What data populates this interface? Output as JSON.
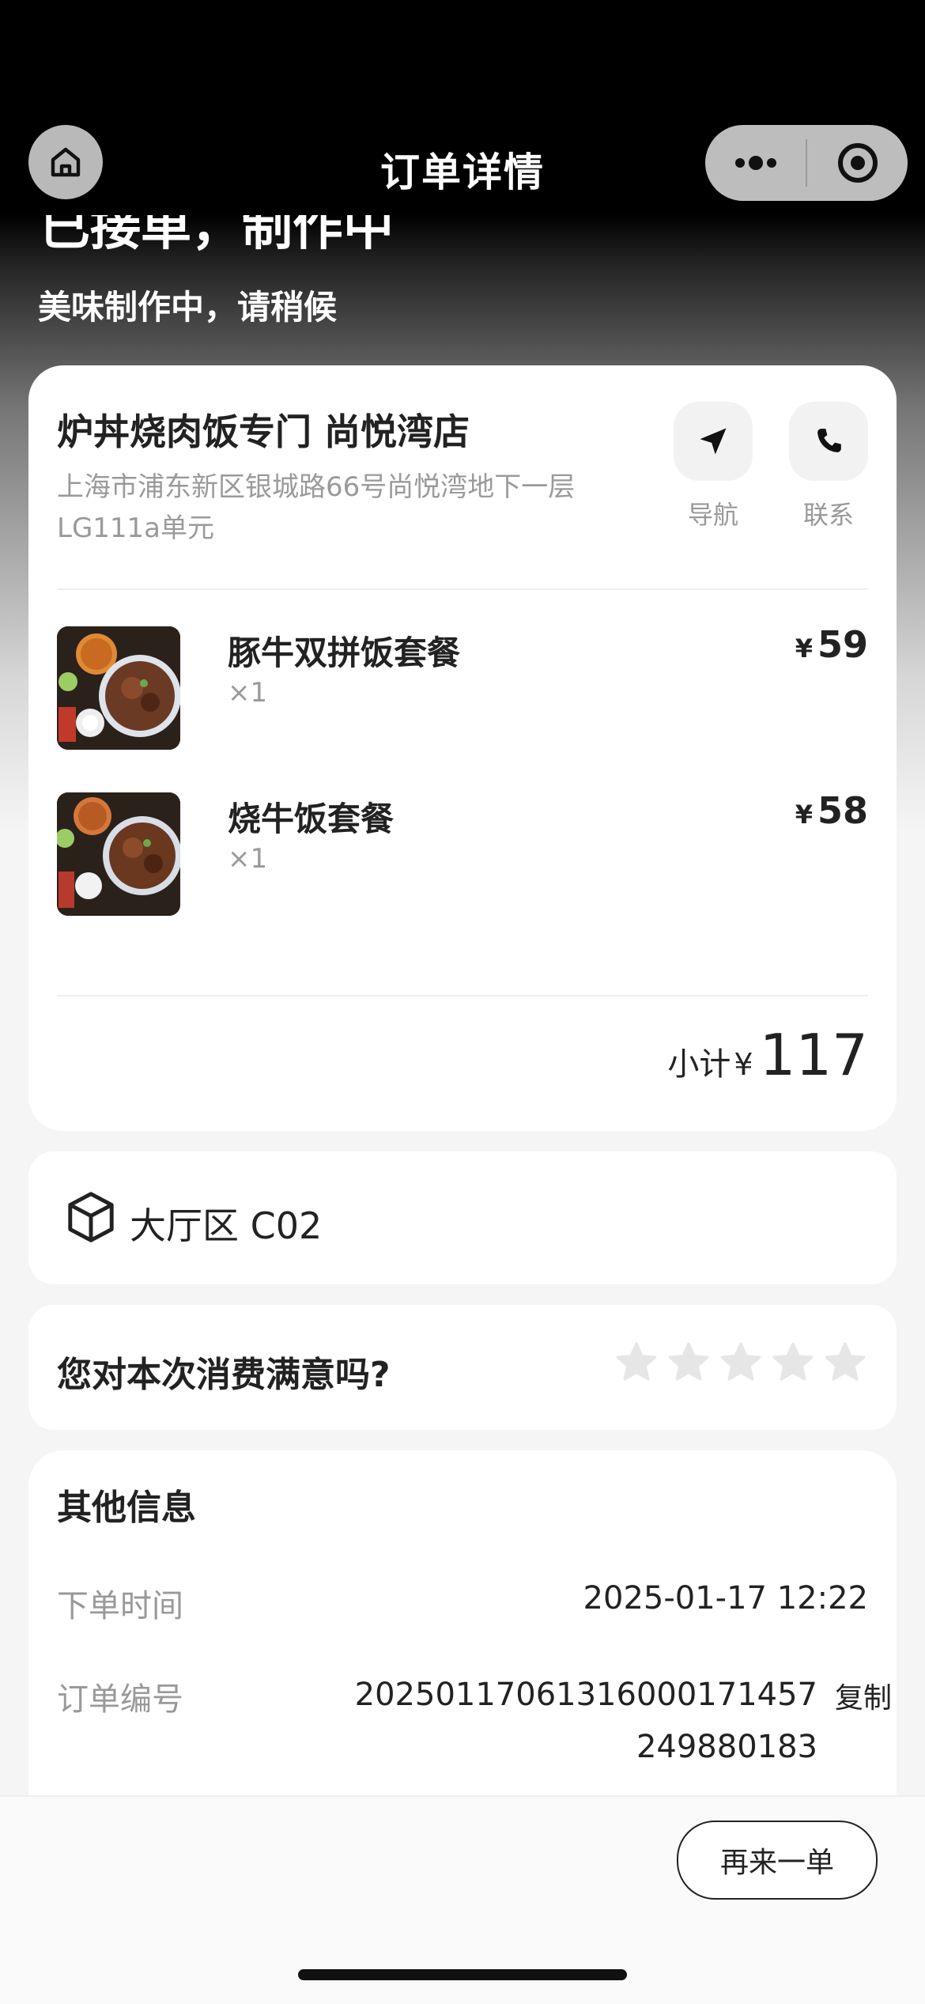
{
  "navbar": {
    "title": "订单详情"
  },
  "status": {
    "title": "已接单，制作中",
    "subtitle": "美味制作中，请稍候"
  },
  "store": {
    "name": "炉丼烧肉饭专门 尚悦湾店",
    "address": "上海市浦东新区银城路66号尚悦湾地下一层LG111a单元",
    "navigate_label": "导航",
    "contact_label": "联系"
  },
  "items": [
    {
      "name": "豚牛双拼饭套餐",
      "qty": "×1",
      "currency": "¥",
      "price": "59"
    },
    {
      "name": "烧牛饭套餐",
      "qty": "×1",
      "currency": "¥",
      "price": "58"
    }
  ],
  "subtotal": {
    "label": "小计",
    "currency": "¥",
    "value": "117"
  },
  "table": {
    "text": "大厅区 C02"
  },
  "rating": {
    "question": "您对本次消费满意吗?",
    "stars": 0,
    "max_stars": 5,
    "star_color": "#e6e6e6"
  },
  "info": {
    "title": "其他信息",
    "order_time_label": "下单时间",
    "order_time": "2025-01-17 12:22",
    "order_no_label": "订单编号",
    "order_no": "20250117061316000171457249880183",
    "copy_label": "复制"
  },
  "actions": {
    "reorder_label": "再来一单"
  }
}
